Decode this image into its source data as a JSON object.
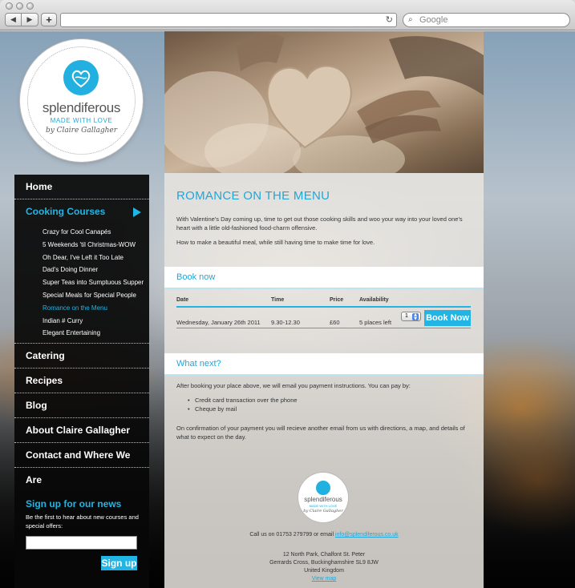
{
  "browser": {
    "back_glyph": "◀",
    "forward_glyph": "▶",
    "new_tab_glyph": "+",
    "reload_glyph": "↻",
    "search_placeholder": "Google",
    "search_glyph": "⌕"
  },
  "brand": {
    "name": "splendiferous",
    "tagline": "MADE WITH LOVE",
    "signature": "by Claire Gallagher",
    "accent_color": "#21b5e6"
  },
  "nav": {
    "home": "Home",
    "cooking_courses": "Cooking Courses",
    "sub_items": [
      "Crazy for Cool Canapés",
      "5 Weekends 'til Christmas-WOW",
      "Oh Dear, I've Left it Too Late",
      "Dad's Doing Dinner",
      "Super Teas into Sumptuous Supper",
      "Special Meals for Special People",
      "Romance on the Menu",
      "Indian # Curry",
      "Elegant Entertaining"
    ],
    "catering": "Catering",
    "recipes": "Recipes",
    "blog": "Blog",
    "about": "About Claire Gallagher",
    "contact": "Contact and Where We Are"
  },
  "signup": {
    "title": "Sign up for our news",
    "text": "Be the first to hear about new courses and special offers:",
    "input_value": "",
    "button": "Sign up"
  },
  "content": {
    "title": "ROMANCE ON THE MENU",
    "para1": "With Valentine's Day coming up, time to get out those cooking skills and woo your way into your loved one's heart with a little old-fashioned food-charm offensive.",
    "para2": "How to make a beautiful meal, while still having time to make time for love.",
    "book_title": "Book now",
    "table_headers": [
      "Date",
      "Time",
      "Price",
      "Availability"
    ],
    "booking_row": {
      "date": "Wednesday, January 26th 2011",
      "time": "9.30-12.30",
      "price": "£60",
      "availability": "5 places left",
      "quantity": "1",
      "button": "Book Now"
    },
    "next_title": "What next?",
    "next_para": "After booking your place above, we will email you payment instructions. You can pay by:",
    "payment_methods": [
      "Credit card transaction over the phone",
      "Cheque by mail"
    ],
    "confirm_para": "On confirmation of your payment you will recieve another email from us with directions, a map, and details of what to expect on the day."
  },
  "footer": {
    "call_prefix": "Call us on 01753 279799 or email ",
    "email": "info@splendiferous.co.uk",
    "address1": "12 North Park, Chalfont St. Peter",
    "address2": "Gerrards Cross, Buckinghamshire SL9 8JW",
    "address3": "United Kingdom",
    "map_link": "View map"
  }
}
